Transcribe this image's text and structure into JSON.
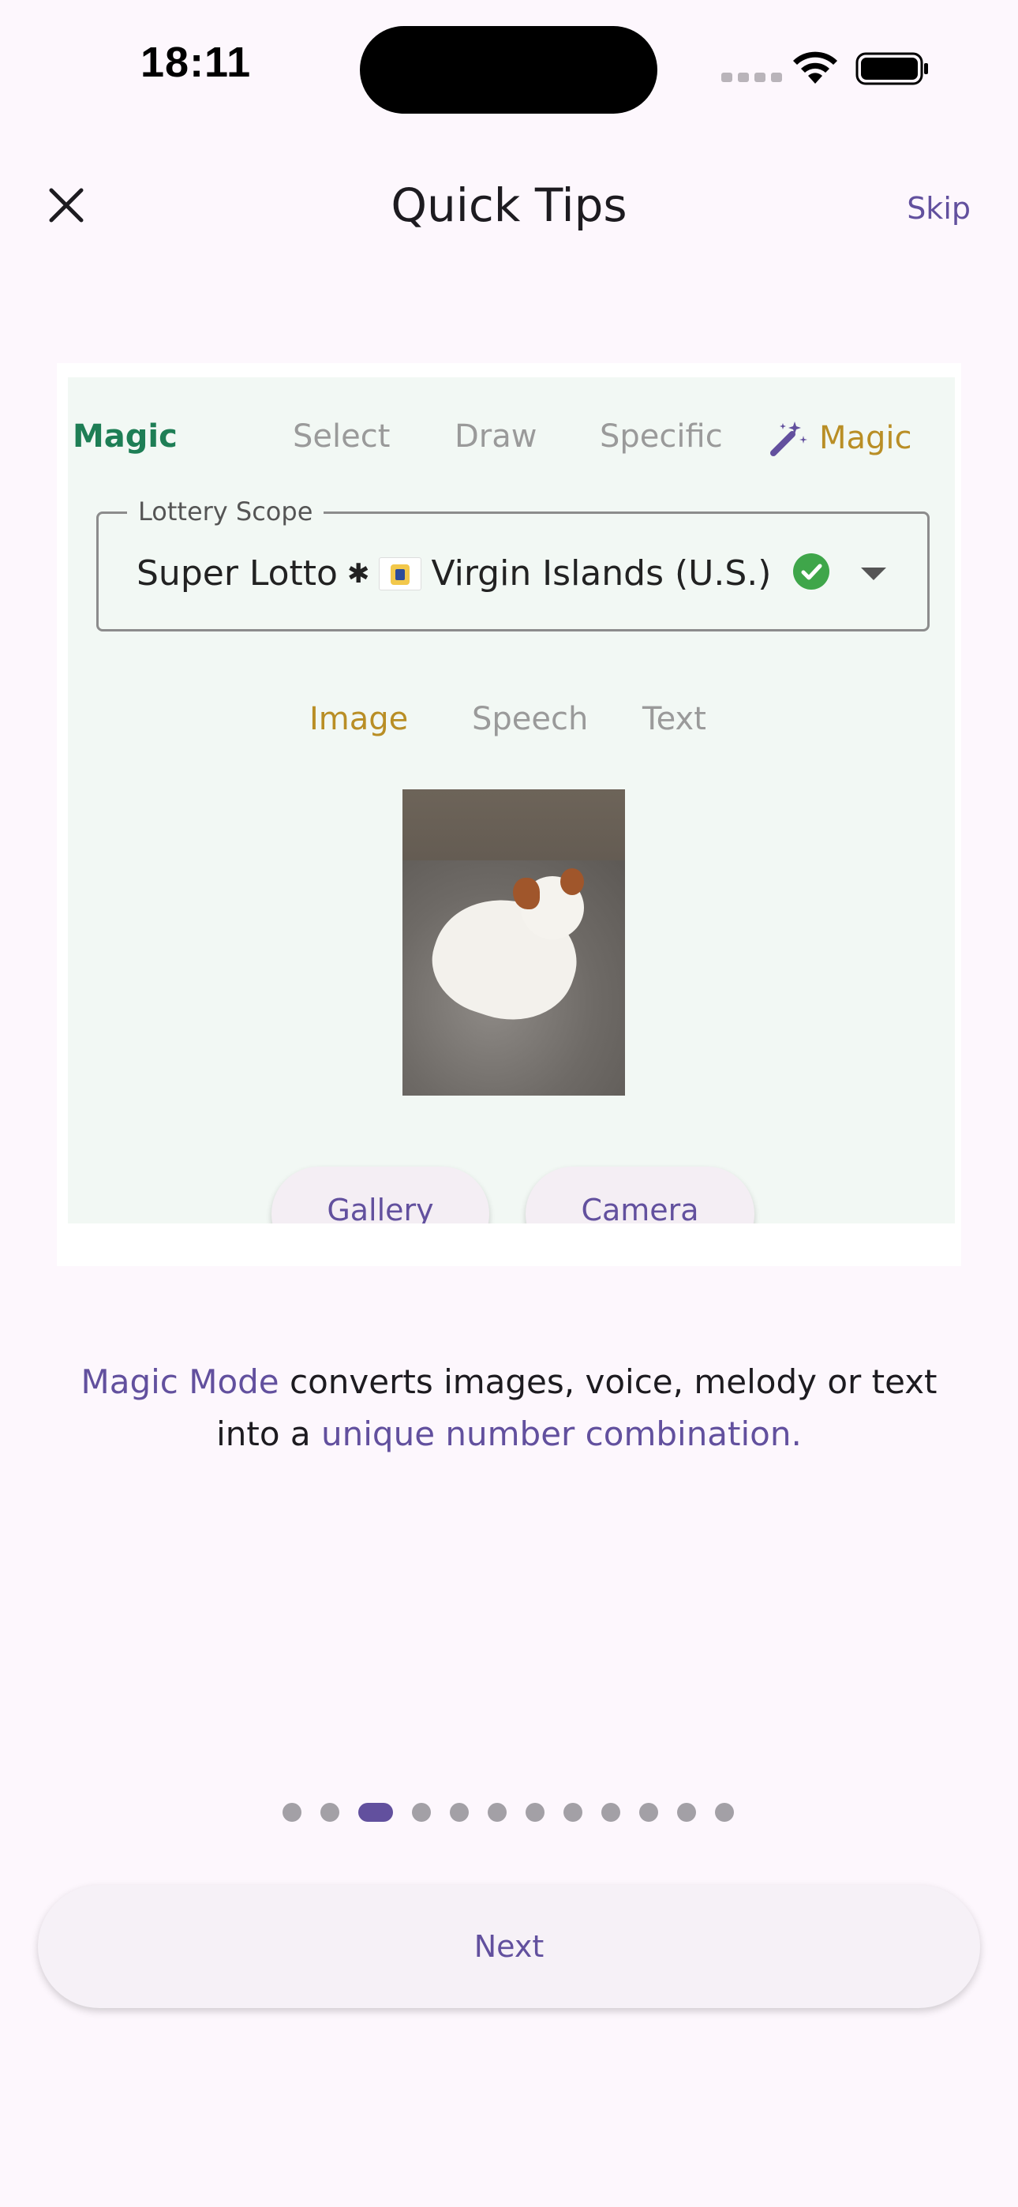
{
  "status_bar": {
    "time": "18:11"
  },
  "header": {
    "title": "Quick Tips",
    "skip_label": "Skip",
    "close_icon": "close-icon"
  },
  "preview": {
    "mode_tabs": [
      {
        "label": "Magic",
        "active": false
      },
      {
        "label": "Select",
        "active": false
      },
      {
        "label": "Draw",
        "active": false
      },
      {
        "label": "Specific",
        "active": false
      },
      {
        "label": "Magic",
        "active": true,
        "icon": "magic-wand-icon"
      }
    ],
    "scope_label": "Lottery Scope",
    "scope_value_game": "Super Lotto",
    "scope_separator": "✱",
    "scope_value_region": "Virgin Islands (U.S.)",
    "input_tabs": [
      {
        "label": "Image",
        "active": true
      },
      {
        "label": "Speech",
        "active": false
      },
      {
        "label": "Text",
        "active": false
      }
    ],
    "gallery_label": "Gallery",
    "camera_label": "Camera"
  },
  "description": {
    "highlight_1": "Magic Mode",
    "text_1": " converts images, voice, melody or text into a ",
    "highlight_2": "unique number combination."
  },
  "pagination": {
    "total": 12,
    "current_index": 2
  },
  "next_label": "Next",
  "colors": {
    "accent": "#62509E",
    "gold": "#B98E25",
    "green": "#1E7E55",
    "background": "#FDF7FD"
  }
}
